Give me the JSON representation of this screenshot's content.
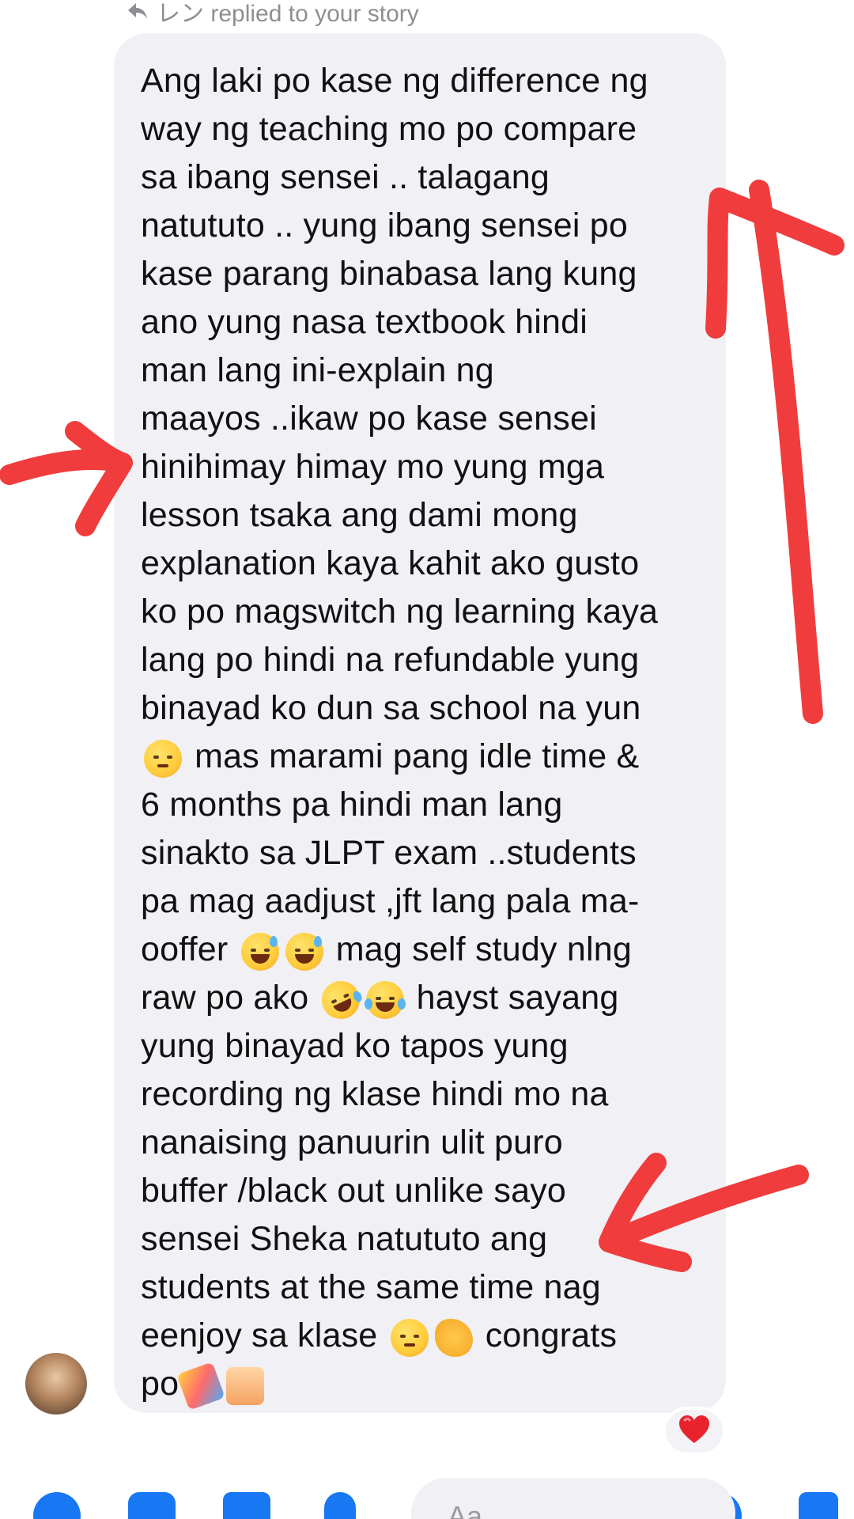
{
  "reply_header": {
    "text": "レン replied to your story"
  },
  "message": {
    "lines": [
      "Ang laki po kase ng difference ng",
      "way ng teaching mo po compare",
      "sa ibang sensei .. talagang",
      "natututo .. yung ibang sensei po",
      "kase parang binabasa lang kung",
      "ano yung nasa textbook hindi",
      "man lang ini-explain ng",
      "maayos ..ikaw po kase sensei",
      "hinihimay himay mo yung mga",
      "lesson tsaka ang dami mong",
      "explanation kaya kahit ako gusto",
      "ko po magswitch ng learning kaya",
      "lang po hindi na refundable yung",
      "binayad ko dun sa school na yun",
      " mas marami pang idle time &",
      "6 months pa hindi man lang",
      "sinakto sa JLPT exam ..students",
      "pa mag aadjust ,jft lang pala ma-",
      "ooffer",
      " mag self study nlng",
      "raw po ako",
      " hayst sayang",
      "yung binayad ko tapos yung",
      "recording ng klase hindi mo na",
      "nanaising panuurin ulit puro",
      "buffer /black out unlike sayo",
      "sensei Sheka natututo ang",
      "students at the same time nag",
      "eenjoy sa klase",
      " congrats",
      "po"
    ]
  },
  "reaction": {
    "emoji": "❤️"
  },
  "composer": {
    "placeholder": "Aa"
  },
  "icons": {
    "reply": "reply-arrow-icon",
    "reaction": "heart-icon",
    "toolbar": [
      "plus-icon",
      "camera-icon",
      "gallery-icon",
      "mic-icon",
      "emoji-icon",
      "like-icon"
    ]
  },
  "colors": {
    "bubble": "#f0f0f5",
    "text": "#111111",
    "annotation_arrow": "#f03c3c",
    "accent": "#1877f2"
  }
}
